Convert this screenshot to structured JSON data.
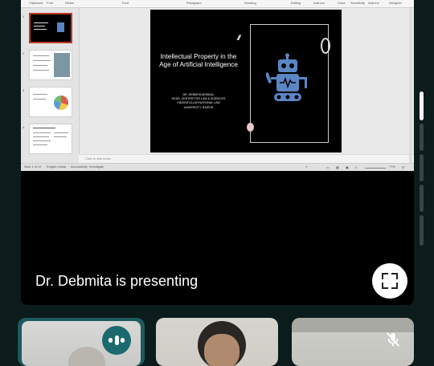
{
  "ribbon": {
    "groups": [
      "Clipboard",
      "Font",
      "Slides",
      "",
      "Font",
      "Paragraph",
      "Drawing",
      "Editing",
      "Add-ins",
      "Voice",
      "Sensitivity",
      "Add-ins",
      "Designer"
    ]
  },
  "slide_panel": {
    "numbers": [
      "1",
      "2",
      "3",
      "4"
    ]
  },
  "slide": {
    "title": "Intellectual Property in the Age of Artificial Intelligence",
    "author_lines": [
      "DR. DEBMITA MONDAL",
      "HEAD, CENTER FOR LAW & SCIENCES",
      "HIDAYATULLAH NATIONAL LAW",
      "UNIVERSITY, RAIPUR"
    ],
    "hatch": "/////",
    "robot_color": "#5a86c4"
  },
  "notes": {
    "placeholder": "Click to add notes"
  },
  "statusbar": {
    "left": "Slide 1 of 13",
    "lang": "English (India)",
    "access": "Accessibility: Investigate",
    "zoom": "77%"
  },
  "meeting": {
    "presenter_text": "Dr. Debmita is presenting",
    "accent": "#1d6a6e"
  },
  "pager": {
    "count": 5,
    "active_index": 0
  }
}
